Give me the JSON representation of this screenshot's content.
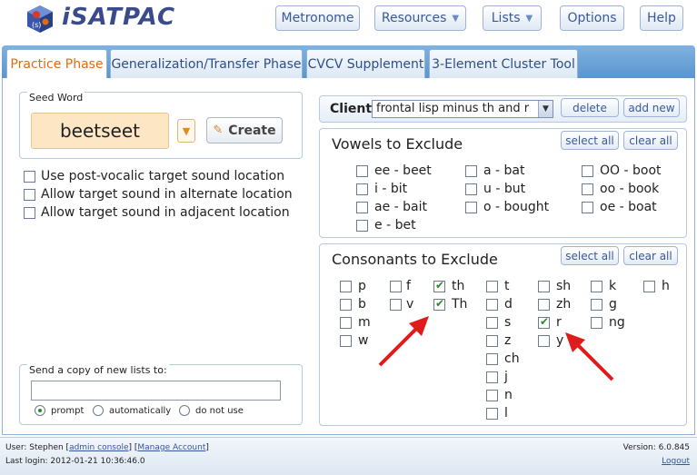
{
  "app": {
    "logo_text": "iSATPAC"
  },
  "nav": {
    "metronome": "Metronome",
    "resources": "Resources",
    "lists": "Lists",
    "options": "Options",
    "help": "Help"
  },
  "tabs": [
    {
      "label": "Practice Phase",
      "active": true
    },
    {
      "label": "Generalization/Transfer Phase",
      "active": false
    },
    {
      "label": "CVCV Supplement",
      "active": false
    },
    {
      "label": "3-Element Cluster Tool",
      "active": false
    }
  ],
  "seed": {
    "legend": "Seed Word",
    "word": "beetseet",
    "create_label": "Create"
  },
  "options": [
    {
      "label": "Use post-vocalic target sound location",
      "checked": false
    },
    {
      "label": "Allow target sound in alternate location",
      "checked": false
    },
    {
      "label": "Allow target sound in adjacent location",
      "checked": false
    }
  ],
  "send_copy": {
    "legend": "Send a copy of new lists to:",
    "email_value": "",
    "radios": [
      {
        "label": "prompt",
        "checked": true
      },
      {
        "label": "automatically",
        "checked": false
      },
      {
        "label": "do not use",
        "checked": false
      }
    ]
  },
  "client": {
    "label": "Client:",
    "selected": "frontal lisp minus th and r",
    "delete_label": "delete",
    "add_new_label": "add new"
  },
  "vowels": {
    "title": "Vowels to Exclude",
    "select_all": "select all",
    "clear_all": "clear all",
    "items": [
      {
        "label": "ee - beet",
        "checked": false
      },
      {
        "label": "i - bit",
        "checked": false
      },
      {
        "label": "ae - bait",
        "checked": false
      },
      {
        "label": "e - bet",
        "checked": false
      },
      {
        "label": "a - bat",
        "checked": false
      },
      {
        "label": "u - but",
        "checked": false
      },
      {
        "label": "o - bought",
        "checked": false
      },
      {
        "label": "OO - boot",
        "checked": false
      },
      {
        "label": "oo - book",
        "checked": false
      },
      {
        "label": "oe - boat",
        "checked": false
      }
    ]
  },
  "consonants": {
    "title": "Consonants to Exclude",
    "select_all": "select all",
    "clear_all": "clear all",
    "items": [
      {
        "label": "p",
        "checked": false
      },
      {
        "label": "b",
        "checked": false
      },
      {
        "label": "m",
        "checked": false
      },
      {
        "label": "w",
        "checked": false
      },
      {
        "label": "f",
        "checked": false
      },
      {
        "label": "v",
        "checked": false
      },
      {
        "label": "th",
        "checked": true
      },
      {
        "label": "Th",
        "checked": true
      },
      {
        "label": "t",
        "checked": false
      },
      {
        "label": "d",
        "checked": false
      },
      {
        "label": "s",
        "checked": false
      },
      {
        "label": "z",
        "checked": false
      },
      {
        "label": "ch",
        "checked": false
      },
      {
        "label": "j",
        "checked": false
      },
      {
        "label": "n",
        "checked": false
      },
      {
        "label": "l",
        "checked": false
      },
      {
        "label": "sh",
        "checked": false
      },
      {
        "label": "zh",
        "checked": false
      },
      {
        "label": "r",
        "checked": true
      },
      {
        "label": "y",
        "checked": false
      },
      {
        "label": "k",
        "checked": false
      },
      {
        "label": "g",
        "checked": false
      },
      {
        "label": "ng",
        "checked": false
      },
      {
        "label": "h",
        "checked": false
      }
    ]
  },
  "footer": {
    "user_prefix": "User: Stephen [",
    "admin_console": "admin console",
    "separator": "] [",
    "manage_account": "Manage Account",
    "suffix": "]",
    "last_login": "Last login: 2012-01-21 10:36:46.0",
    "version": "Version: 6.0.845",
    "logout": "Logout"
  },
  "colors": {
    "accent": "#e06b10",
    "nav_text": "#3a5a98",
    "annotation_arrow": "#e01b1b"
  }
}
